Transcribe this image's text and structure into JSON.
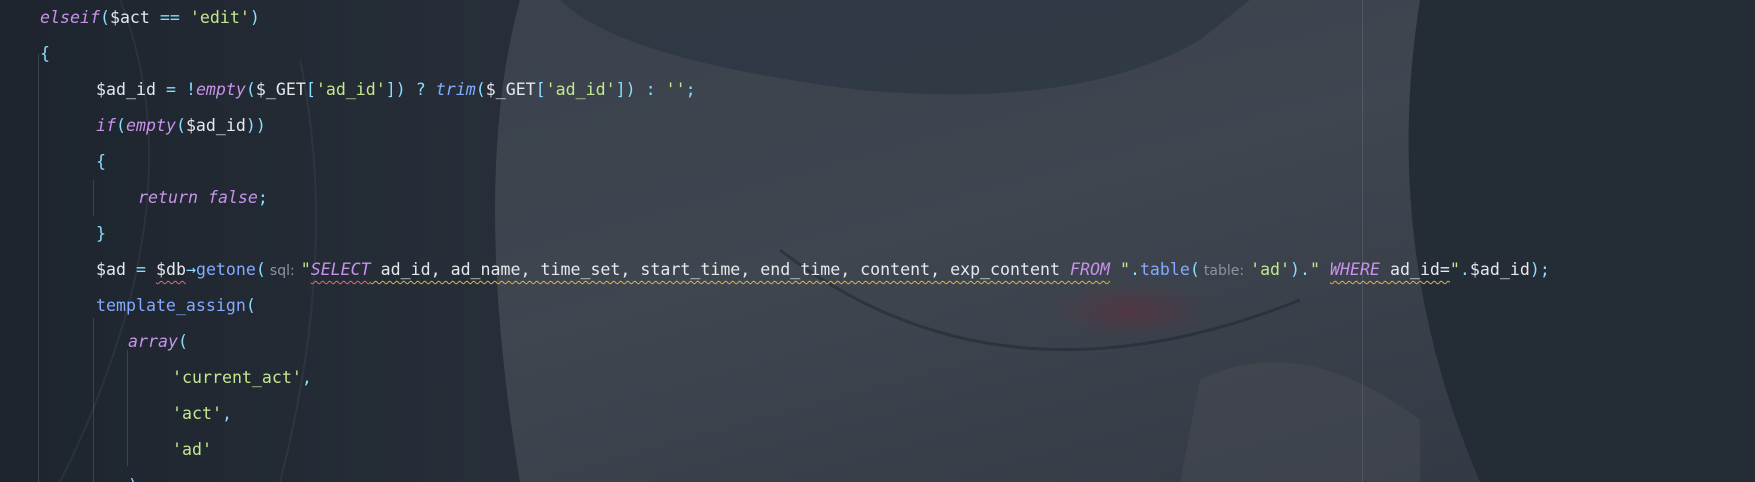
{
  "editor": {
    "language": "PHP",
    "hints": {
      "sql": "sql:",
      "table": "table:"
    },
    "lines": [
      {
        "tokens": [
          {
            "t": "elseif",
            "c": "kw"
          },
          {
            "t": "(",
            "c": "punc"
          },
          {
            "t": "$act",
            "c": "var"
          },
          {
            "t": " == ",
            "c": "op"
          },
          {
            "t": "'edit'",
            "c": "str"
          },
          {
            "t": ")",
            "c": "punc"
          }
        ]
      },
      {
        "tokens": [
          {
            "t": "{",
            "c": "punc"
          }
        ]
      },
      {
        "tokens": [
          {
            "t": "$ad_id",
            "c": "var"
          },
          {
            "t": " = ",
            "c": "op"
          },
          {
            "t": "!",
            "c": "op"
          },
          {
            "t": "empty",
            "c": "kw"
          },
          {
            "t": "(",
            "c": "punc"
          },
          {
            "t": "$_GET",
            "c": "var"
          },
          {
            "t": "[",
            "c": "punc"
          },
          {
            "t": "'ad_id'",
            "c": "str"
          },
          {
            "t": "])",
            "c": "punc"
          },
          {
            "t": " ? ",
            "c": "op"
          },
          {
            "t": "trim",
            "c": "fni"
          },
          {
            "t": "(",
            "c": "punc"
          },
          {
            "t": "$_GET",
            "c": "var"
          },
          {
            "t": "[",
            "c": "punc"
          },
          {
            "t": "'ad_id'",
            "c": "str"
          },
          {
            "t": "])",
            "c": "punc"
          },
          {
            "t": " : ",
            "c": "op"
          },
          {
            "t": "''",
            "c": "str"
          },
          {
            "t": ";",
            "c": "punc"
          }
        ]
      },
      {
        "tokens": [
          {
            "t": "if",
            "c": "kw"
          },
          {
            "t": "(",
            "c": "punc"
          },
          {
            "t": "empty",
            "c": "kw"
          },
          {
            "t": "(",
            "c": "punc"
          },
          {
            "t": "$ad_id",
            "c": "var"
          },
          {
            "t": "))",
            "c": "punc"
          }
        ]
      },
      {
        "tokens": [
          {
            "t": "{",
            "c": "punc"
          }
        ]
      },
      {
        "tokens": [
          {
            "t": "return",
            "c": "kw"
          },
          {
            "t": " ",
            "c": "plain"
          },
          {
            "t": "false",
            "c": "kw"
          },
          {
            "t": ";",
            "c": "punc"
          }
        ]
      },
      {
        "tokens": [
          {
            "t": "}",
            "c": "punc"
          }
        ]
      },
      {
        "tokens": [
          {
            "t": "$ad",
            "c": "var"
          },
          {
            "t": " = ",
            "c": "op"
          },
          {
            "t": "$db",
            "c": "var",
            "u": "red"
          },
          {
            "t": "→",
            "c": "op"
          },
          {
            "t": "getone",
            "c": "fn"
          },
          {
            "t": "(",
            "c": "punc"
          },
          {
            "hint": "sql"
          },
          {
            "t": "\"",
            "c": "str"
          },
          {
            "t": "SELECT",
            "c": "sqlkw",
            "u": "red"
          },
          {
            "t": " ad_id, ad_name, time_set, start_time, end_time, content, exp_content ",
            "c": "sqlid",
            "u": "yellow"
          },
          {
            "t": "FROM",
            "c": "sqlkw",
            "u": "yellow"
          },
          {
            "t": " \"",
            "c": "str"
          },
          {
            "t": ".",
            "c": "op"
          },
          {
            "t": "table",
            "c": "fn"
          },
          {
            "t": "(",
            "c": "punc"
          },
          {
            "hint": "table"
          },
          {
            "t": "'ad'",
            "c": "str"
          },
          {
            "t": ")",
            "c": "punc"
          },
          {
            "t": ".",
            "c": "op"
          },
          {
            "t": "\" ",
            "c": "str"
          },
          {
            "t": "WHERE",
            "c": "sqlkw",
            "u": "yellow"
          },
          {
            "t": " ad_id=",
            "c": "sqlid",
            "u": "yellow"
          },
          {
            "t": "\"",
            "c": "str"
          },
          {
            "t": ".",
            "c": "op"
          },
          {
            "t": "$ad_id",
            "c": "var"
          },
          {
            "t": ");",
            "c": "punc"
          }
        ]
      },
      {
        "tokens": [
          {
            "t": "template_assign",
            "c": "fn"
          },
          {
            "t": "(",
            "c": "punc"
          }
        ]
      },
      {
        "tokens": [
          {
            "t": "array",
            "c": "kw"
          },
          {
            "t": "(",
            "c": "punc"
          }
        ]
      },
      {
        "tokens": [
          {
            "t": "'current_act'",
            "c": "str"
          },
          {
            "t": ",",
            "c": "punc"
          }
        ]
      },
      {
        "tokens": [
          {
            "t": "'act'",
            "c": "str"
          },
          {
            "t": ",",
            "c": "punc"
          }
        ]
      },
      {
        "tokens": [
          {
            "t": "'ad'",
            "c": "str"
          }
        ]
      },
      {
        "tokens": [
          {
            "t": ")",
            "c": "punc"
          }
        ]
      }
    ]
  }
}
